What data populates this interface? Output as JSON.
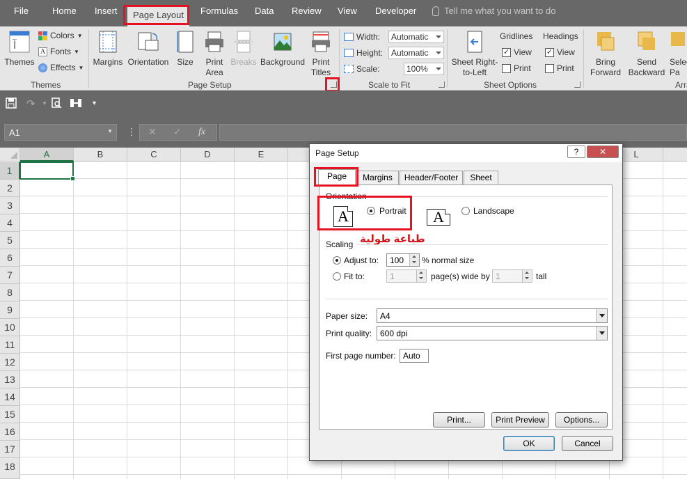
{
  "tabs": [
    "File",
    "Home",
    "Insert",
    "Page Layout",
    "Formulas",
    "Data",
    "Review",
    "View",
    "Developer"
  ],
  "tell_me": "Tell me what you want to do",
  "ribbon": {
    "themes": {
      "themes": "Themes",
      "colors": "Colors",
      "fonts": "Fonts",
      "effects": "Effects",
      "group": "Themes"
    },
    "page_setup": {
      "margins": "Margins",
      "orientation": "Orientation",
      "size": "Size",
      "print_area_1": "Print",
      "print_area_2": "Area",
      "breaks": "Breaks",
      "background": "Background",
      "print_titles_1": "Print",
      "print_titles_2": "Titles",
      "group": "Page Setup"
    },
    "scale": {
      "width_label": "Width:",
      "width_value": "Automatic",
      "height_label": "Height:",
      "height_value": "Automatic",
      "scale_label": "Scale:",
      "scale_value": "100%",
      "group": "Scale to Fit"
    },
    "sheet_options": {
      "rtl_1": "Sheet Right-",
      "rtl_2": "to-Left",
      "gridlines": "Gridlines",
      "headings": "Headings",
      "view": "View",
      "print": "Print",
      "gridlines_view": true,
      "gridlines_print": false,
      "headings_view": true,
      "headings_print": false,
      "group": "Sheet Options"
    },
    "arrange": {
      "bring_1": "Bring",
      "bring_2": "Forward",
      "send_1": "Send",
      "send_2": "Backward",
      "select_1": "Selec",
      "select_2": "Pa",
      "group": "Arra"
    }
  },
  "name_box": "A1",
  "fx": "fx",
  "columns": [
    "A",
    "B",
    "C",
    "D",
    "E",
    "L"
  ],
  "rows": [
    "1",
    "2",
    "3",
    "4",
    "5",
    "6",
    "7",
    "8",
    "9",
    "10",
    "11",
    "12",
    "13",
    "14",
    "15",
    "16",
    "17",
    "18"
  ],
  "dialog": {
    "title": "Page Setup",
    "help": "?",
    "tabs": [
      "Page",
      "Margins",
      "Header/Footer",
      "Sheet"
    ],
    "orientation_label": "Orientation",
    "portrait": "Portrait",
    "landscape": "Landscape",
    "annotation": "طباعة طولية",
    "scaling_label": "Scaling",
    "adjust_to": "Adjust to:",
    "adjust_value": "100",
    "normal_size": "% normal size",
    "fit_to": "Fit to:",
    "fit_wide_value": "1",
    "pages_wide_by": "page(s) wide by",
    "fit_tall_value": "1",
    "tall": "tall",
    "paper_size_label": "Paper size:",
    "paper_size": "A4",
    "print_quality_label": "Print quality:",
    "print_quality": "600 dpi",
    "first_page_label": "First page number:",
    "first_page_value": "Auto",
    "print_btn": "Print...",
    "preview_btn": "Print Preview",
    "options_btn": "Options...",
    "ok": "OK",
    "cancel": "Cancel"
  },
  "colors": {
    "accent_green": "#217346",
    "highlight_red": "#e81123"
  }
}
